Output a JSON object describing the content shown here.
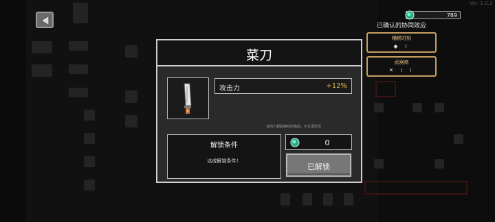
{
  "version": "Ver. 1.0.3",
  "currency": {
    "value": "789",
    "icon": "gem-icon"
  },
  "synergy": {
    "title": "已确认的协同效应",
    "cards": [
      {
        "name": "糟糕时刻",
        "icons": "◆ ⁞"
      },
      {
        "name": "武器商",
        "icons": "✕ ⁞ ⁞"
      }
    ]
  },
  "modal": {
    "title": "菜刀",
    "stat_label": "攻击力",
    "stat_value": "+12%",
    "hint": "任何人都能拥有的物品，不过很危险",
    "condition_title": "解锁条件",
    "condition_text": "达成解锁条件！",
    "cost_value": "0",
    "unlock_label": "已解锁"
  },
  "colors": {
    "accent_gold": "#f0c24a",
    "gem": "#3fd3a5",
    "border": "#cfcfcf"
  }
}
